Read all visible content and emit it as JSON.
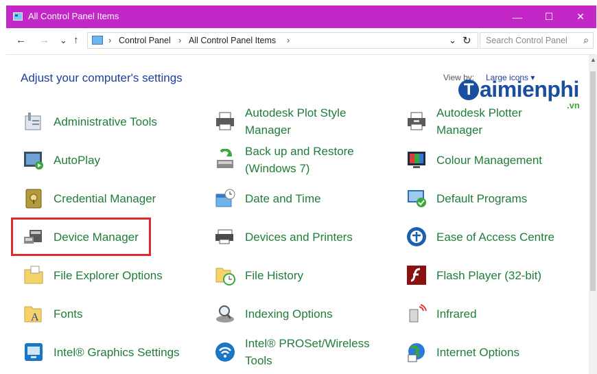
{
  "window": {
    "title": "All Control Panel Items",
    "minimize": "—",
    "maximize": "☐",
    "close": "✕"
  },
  "nav": {
    "back": "←",
    "forward": "→",
    "recent": "⌄",
    "up": "↑"
  },
  "address": {
    "crumbs": [
      "Control Panel",
      "All Control Panel Items"
    ],
    "dropdown": "⌄",
    "refresh": "↻"
  },
  "search": {
    "placeholder": "Search Control Panel",
    "icon": "⌕"
  },
  "heading": "Adjust your computer's settings",
  "view": {
    "label": "View by:",
    "value": "Large icons ▾"
  },
  "watermark": {
    "text": "aimienphi",
    "t": "T",
    "vn": ".vn"
  },
  "items": [
    {
      "label": "Administrative Tools",
      "icon": "administrative-tools-icon"
    },
    {
      "label": "Autodesk Plot Style Manager",
      "icon": "printer-icon"
    },
    {
      "label": "Autodesk Plotter Manager",
      "icon": "plotter-icon"
    },
    {
      "label": "AutoPlay",
      "icon": "autoplay-icon"
    },
    {
      "label": "Back up and Restore (Windows 7)",
      "icon": "backup-icon"
    },
    {
      "label": "Colour Management",
      "icon": "colour-management-icon"
    },
    {
      "label": "Credential Manager",
      "icon": "credential-icon"
    },
    {
      "label": "Date and Time",
      "icon": "date-time-icon"
    },
    {
      "label": "Default Programs",
      "icon": "default-programs-icon"
    },
    {
      "label": "Device Manager",
      "icon": "device-manager-icon"
    },
    {
      "label": "Devices and Printers",
      "icon": "devices-printers-icon"
    },
    {
      "label": "Ease of Access Centre",
      "icon": "ease-of-access-icon"
    },
    {
      "label": "File Explorer Options",
      "icon": "folder-options-icon"
    },
    {
      "label": "File History",
      "icon": "file-history-icon"
    },
    {
      "label": "Flash Player (32-bit)",
      "icon": "flash-icon"
    },
    {
      "label": "Fonts",
      "icon": "fonts-icon"
    },
    {
      "label": "Indexing Options",
      "icon": "indexing-icon"
    },
    {
      "label": "Infrared",
      "icon": "infrared-icon"
    },
    {
      "label": "Intel® Graphics Settings",
      "icon": "intel-graphics-icon"
    },
    {
      "label": "Intel® PROSet/Wireless Tools",
      "icon": "wireless-icon"
    },
    {
      "label": "Internet Options",
      "icon": "internet-options-icon"
    }
  ],
  "colors": {
    "titlebar": "#c427c8",
    "heading": "#1e3e9c",
    "item_text": "#1f7d3a",
    "highlight": "#e02a2a"
  }
}
